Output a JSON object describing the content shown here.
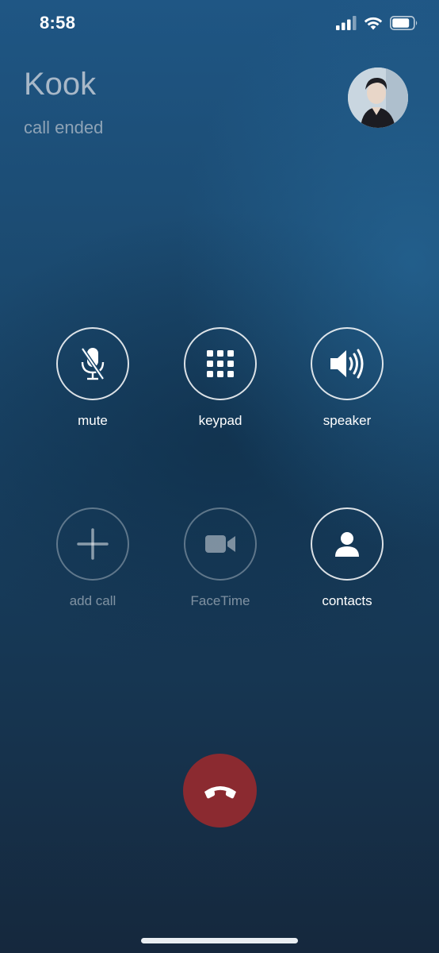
{
  "status_bar": {
    "time": "8:58"
  },
  "call": {
    "caller_name": "Kook",
    "status": "call ended"
  },
  "controls": {
    "mute": {
      "label": "mute",
      "icon": "mic-slash-icon",
      "enabled": true
    },
    "keypad": {
      "label": "keypad",
      "icon": "keypad-grid-icon",
      "enabled": true
    },
    "speaker": {
      "label": "speaker",
      "icon": "speaker-wave-icon",
      "enabled": true
    },
    "add_call": {
      "label": "add call",
      "icon": "plus-icon",
      "enabled": false
    },
    "facetime": {
      "label": "FaceTime",
      "icon": "video-camera-icon",
      "enabled": false
    },
    "contacts": {
      "label": "contacts",
      "icon": "person-icon",
      "enabled": true
    }
  },
  "colors": {
    "end_call": "#8b2a30",
    "background_top": "#1f5684",
    "background_bottom": "#15283d"
  }
}
